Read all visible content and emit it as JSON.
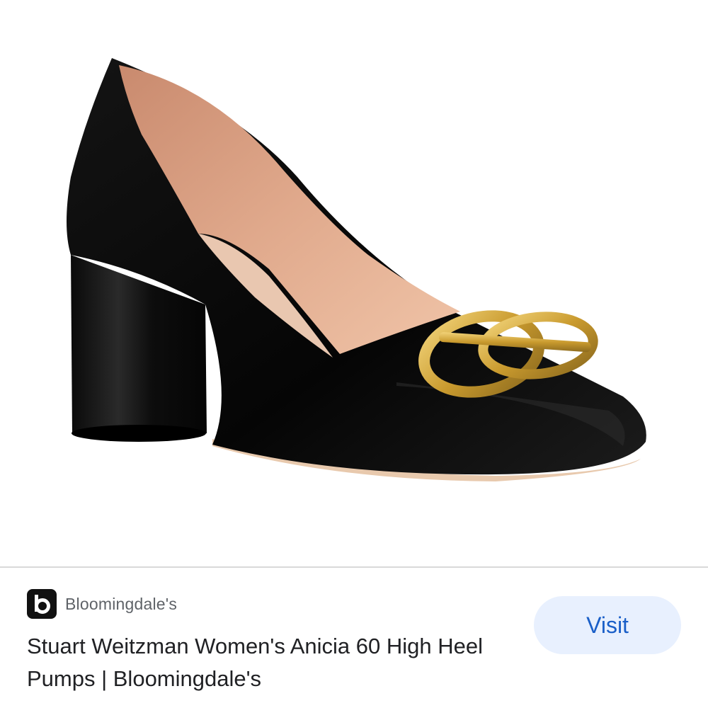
{
  "result": {
    "image_alt": "Black leather block heel pump with gold circular buckle",
    "source": {
      "name": "Bloomingdale's",
      "favicon_letter": "b"
    },
    "title": "Stuart Weitzman Women's Anicia 60 High Heel Pumps | Bloomingdale's",
    "visit_label": "Visit"
  },
  "colors": {
    "accent": "#1a5fc8",
    "button_bg": "#e8f0fe",
    "text_primary": "#202124",
    "text_secondary": "#5f6368"
  },
  "icons": {
    "favicon": "bloomingdales-b-icon"
  }
}
